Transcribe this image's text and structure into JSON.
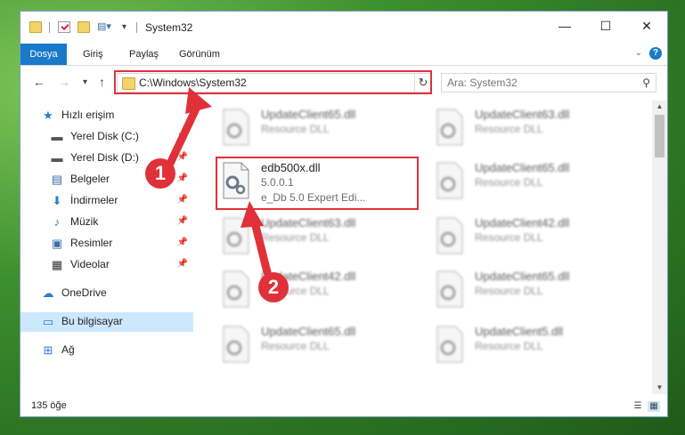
{
  "window": {
    "title": "System32",
    "controls": {
      "minimize": "—",
      "maximize": "☐",
      "close": "✕"
    }
  },
  "ribbon": {
    "tabs": [
      "Dosya",
      "Giriş",
      "Paylaş",
      "Görünüm"
    ]
  },
  "navigation": {
    "back": "←",
    "forward": "→",
    "recent": "▾",
    "up": "↑",
    "address": "C:\\Windows\\System32",
    "search_placeholder": "Ara: System32"
  },
  "sidebar": {
    "items": [
      {
        "label": "Hızlı erişim",
        "icon": "star-icon"
      },
      {
        "label": "Yerel Disk (C:)",
        "icon": "drive-icon",
        "pinned": true
      },
      {
        "label": "Yerel Disk (D:)",
        "icon": "drive-icon",
        "pinned": true
      },
      {
        "label": "Belgeler",
        "icon": "documents-icon",
        "pinned": true
      },
      {
        "label": "İndirmeler",
        "icon": "download-icon",
        "pinned": true
      },
      {
        "label": "Müzik",
        "icon": "music-icon",
        "pinned": true
      },
      {
        "label": "Resimler",
        "icon": "pictures-icon",
        "pinned": true
      },
      {
        "label": "Videolar",
        "icon": "videos-icon",
        "pinned": true
      },
      {
        "label": "OneDrive",
        "icon": "cloud-icon"
      },
      {
        "label": "Bu bilgisayar",
        "icon": "computer-icon",
        "selected": true
      },
      {
        "label": "Ağ",
        "icon": "network-icon"
      }
    ]
  },
  "files": [
    {
      "name": "UpdateClient65.dll",
      "desc": "Resource DLL",
      "blurred": true
    },
    {
      "name": "UpdateClient63.dll",
      "desc": "Resource DLL",
      "blurred": true
    },
    {
      "name": "edb500x.dll",
      "desc": "5.0.0.1",
      "extra": "e_Db 5.0 Expert Edi...",
      "blurred": false
    },
    {
      "name": "UpdateClient65.dll",
      "desc": "Resource DLL",
      "blurred": true
    },
    {
      "name": "UpdateClient63.dll",
      "desc": "Resource DLL",
      "blurred": true
    },
    {
      "name": "UpdateClient42.dll",
      "desc": "Resource DLL",
      "blurred": true
    },
    {
      "name": "UpdateClient42.dll",
      "desc": "Resource DLL",
      "blurred": true
    },
    {
      "name": "UpdateClient65.dll",
      "desc": "Resource DLL",
      "blurred": true
    },
    {
      "name": "UpdateClient65.dll",
      "desc": "Resource DLL",
      "blurred": true
    },
    {
      "name": "UpdateClient5.dll",
      "desc": "Resource DLL",
      "blurred": true
    }
  ],
  "status": {
    "count": "135 öğe"
  },
  "annotations": {
    "step1": "1",
    "step2": "2"
  },
  "colors": {
    "accent": "#1979ca",
    "highlight": "#e0313a",
    "selection": "#cce8ff"
  }
}
